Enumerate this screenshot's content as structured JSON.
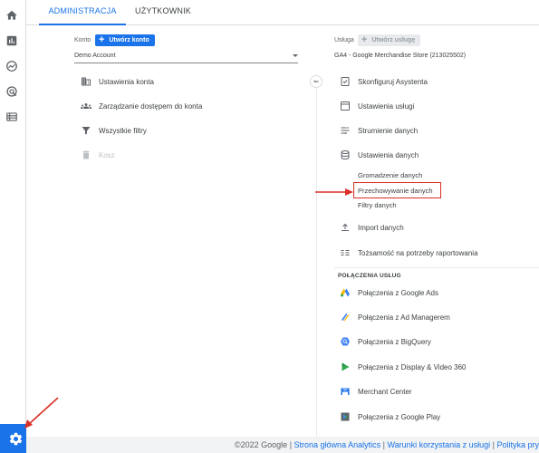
{
  "nav_rail": {
    "items": [
      {
        "icon": "home-icon"
      },
      {
        "icon": "reports-icon"
      },
      {
        "icon": "explore-icon"
      },
      {
        "icon": "advertising-icon"
      },
      {
        "icon": "configure-icon"
      }
    ],
    "admin_icon": "gear-icon",
    "active_color": "#1a73e8"
  },
  "tabs": {
    "admin": "ADMINISTRACJA",
    "user": "UŻYTKOWNIK"
  },
  "account": {
    "label": "Konto",
    "create_button": "Utwórz konto",
    "selected": "Demo Account",
    "menu": [
      {
        "label": "Ustawienia konta",
        "icon": "building-icon",
        "disabled": false
      },
      {
        "label": "Zarządzanie dostępem do konta",
        "icon": "people-icon",
        "disabled": false
      },
      {
        "label": "Wszystkie filtry",
        "icon": "filter-icon",
        "disabled": false
      },
      {
        "label": "Kosz",
        "icon": "trash-icon",
        "disabled": true
      }
    ]
  },
  "property": {
    "label": "Usługa",
    "create_button": "Utwórz usługę",
    "selected": "GA4 - Google Merchandise Store (213025502)",
    "menu": [
      {
        "label": "Skonfiguruj Asystenta",
        "icon": "checklist-icon"
      },
      {
        "label": "Ustawienia usługi",
        "icon": "window-icon"
      },
      {
        "label": "Strumienie danych",
        "icon": "streams-icon"
      },
      {
        "label": "Ustawienia danych",
        "icon": "database-icon"
      }
    ],
    "data_settings_sub": [
      {
        "label": "Gromadzenie danych"
      },
      {
        "label": "Przechowywanie danych"
      },
      {
        "label": "Filtry danych"
      }
    ],
    "menu_after": [
      {
        "label": "Import danych",
        "icon": "upload-icon"
      },
      {
        "label": "Tożsamość na potrzeby raportowania",
        "icon": "identity-icon"
      }
    ],
    "links_section_title": "POŁĄCZENIA USŁUG",
    "links": [
      {
        "label": "Połączenia z Google Ads",
        "icon": "google-ads-icon"
      },
      {
        "label": "Połączenia z Ad Managerem",
        "icon": "ad-manager-icon"
      },
      {
        "label": "Połączenia z BigQuery",
        "icon": "bigquery-icon"
      },
      {
        "label": "Połączenia z Display & Video 360",
        "icon": "dv360-icon"
      },
      {
        "label": "Merchant Center",
        "icon": "merchant-center-icon"
      },
      {
        "label": "Połączenia z Google Play",
        "icon": "google-play-icon"
      }
    ]
  },
  "footer": {
    "copyright": "©2022 Google",
    "sep": " | ",
    "link1": "Strona główna Analytics",
    "link2": "Warunki korzystania z usługi",
    "link3": "Polityka prywatności"
  },
  "annotation_color": "#d93025"
}
